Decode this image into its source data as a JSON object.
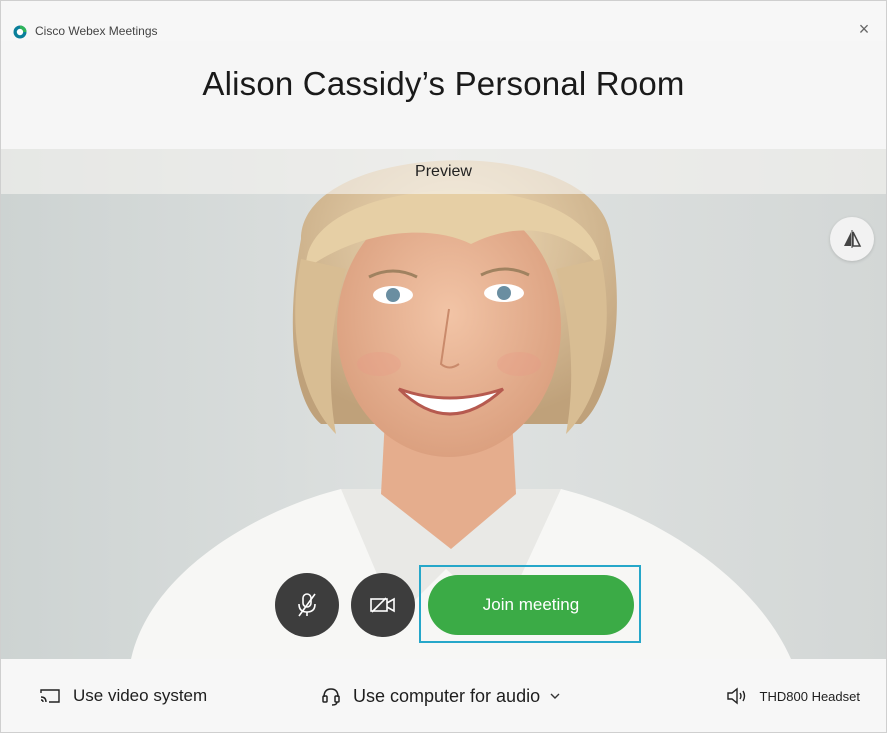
{
  "titlebar": {
    "app_name": "Cisco Webex Meetings",
    "logo_icon": "webex-logo-icon",
    "close_label": "×"
  },
  "room": {
    "title": "Alison Cassidy’s Personal Room"
  },
  "preview": {
    "label": "Preview",
    "self_view_icon": "mirror-flip-icon"
  },
  "controls": {
    "mute_icon": "microphone-muted-icon",
    "video_icon": "video-off-icon",
    "join_label": "Join meeting"
  },
  "bottom": {
    "video_system_label": "Use video system",
    "video_system_icon": "cast-screen-icon",
    "audio_label": "Use computer for audio",
    "audio_icon": "headset-icon",
    "audio_chevron_icon": "chevron-down-icon",
    "speaker_label": "THD800 Headset",
    "speaker_icon": "speaker-icon"
  },
  "colors": {
    "join_green": "#3bab46",
    "focus_ring": "#26a7c9",
    "control_dark": "#3d3d3d"
  }
}
